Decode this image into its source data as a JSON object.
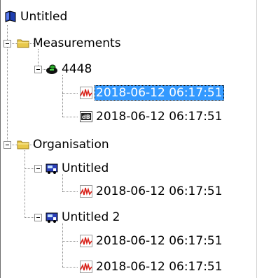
{
  "tree": {
    "root": {
      "label": "Untitled",
      "icon": "book-icon"
    },
    "measurements": {
      "label": "Measurements",
      "icon": "folder-icon",
      "device": {
        "label": "4448",
        "icon": "device-icon",
        "items": [
          {
            "label": "2018-06-12 06:17:51",
            "icon": "chart-icon",
            "selected": true
          },
          {
            "label": "2018-06-12 06:17:51",
            "icon": "db-icon",
            "selected": false
          }
        ]
      }
    },
    "organisation": {
      "label": "Organisation",
      "icon": "folder-icon",
      "groups": [
        {
          "label": "Untitled",
          "icon": "vehicle-icon",
          "items": [
            {
              "label": "2018-06-12 06:17:51",
              "icon": "chart-icon"
            }
          ]
        },
        {
          "label": "Untitled 2",
          "icon": "vehicle-icon",
          "items": [
            {
              "label": "2018-06-12 06:17:51",
              "icon": "chart-icon"
            },
            {
              "label": "2018-06-12 06:17:51",
              "icon": "chart-icon"
            }
          ]
        }
      ]
    }
  },
  "colors": {
    "selection": "#3399ff",
    "folder": "#e8c84a",
    "book": "#1f3fb0",
    "chart_red": "#d9221a"
  }
}
